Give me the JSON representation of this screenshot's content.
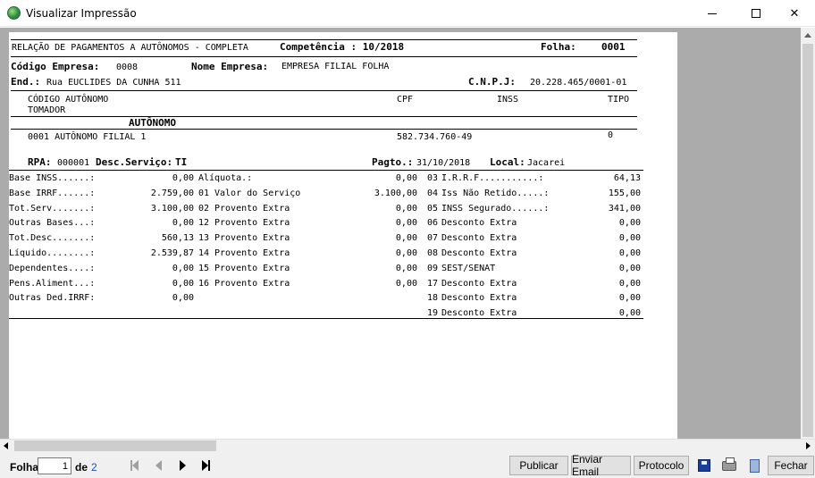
{
  "window": {
    "title": "Visualizar Impressão"
  },
  "report": {
    "header": {
      "title": "RELAÇÃO DE PAGAMENTOS A AUTÔNOMOS - COMPLETA",
      "competencia_label": "Competência : 10/2018",
      "folha_label": "Folha:",
      "folha_value": "0001"
    },
    "empresa": {
      "codigo_label": "Código Empresa:",
      "codigo_value": "0008",
      "nome_label": "Nome Empresa:",
      "nome_value": "EMPRESA FILIAL FOLHA",
      "end_label": "End.:",
      "end_value": "Rua EUCLIDES DA CUNHA 511",
      "cnpj_label": "C.N.P.J:",
      "cnpj_value": "20.228.465/0001-01"
    },
    "columns": {
      "codigo_autonomo": "CÓDIGO AUTÔNOMO",
      "tomador": "TOMADOR",
      "cpf": "CPF",
      "inss": "INSS",
      "tipo": "TIPO",
      "autonomo_section": "AUTÔNOMO"
    },
    "autonomo": {
      "codigo_nome": "0001 AUTÔNOMO FILIAL 1",
      "cpf": "582.734.760-49",
      "tipo": "0"
    },
    "rpa": {
      "rpa_label": "RPA:",
      "rpa_value": "000001",
      "desc_label": "Desc.Serviço:",
      "desc_value": "TI",
      "pagto_label": "Pagto.:",
      "pagto_value": "31/10/2018",
      "local_label": "Local:",
      "local_value": "Jacarei"
    },
    "rows": [
      {
        "l_label": "Base INSS......:",
        "l_value": "0,00",
        "m_code": "",
        "m_label": "Alíquota.:",
        "m_value": "0,00",
        "r_code": "03",
        "r_label": "I.R.R.F...........:",
        "r_value": "64,13"
      },
      {
        "l_label": "Base IRRF......:",
        "l_value": "2.759,00",
        "m_code": "01",
        "m_label": "Valor do Serviço",
        "m_value": "3.100,00",
        "r_code": "04",
        "r_label": "Iss Não Retido.....:",
        "r_value": "155,00"
      },
      {
        "l_label": "Tot.Serv.......:",
        "l_value": "3.100,00",
        "m_code": "02",
        "m_label": "Provento Extra",
        "m_value": "0,00",
        "r_code": "05",
        "r_label": "INSS Segurado......:",
        "r_value": "341,00"
      },
      {
        "l_label": "Outras Bases...:",
        "l_value": "0,00",
        "m_code": "12",
        "m_label": "Provento Extra",
        "m_value": "0,00",
        "r_code": "06",
        "r_label": "Desconto Extra",
        "r_value": "0,00"
      },
      {
        "l_label": "Tot.Desc.......:",
        "l_value": "560,13",
        "m_code": "13",
        "m_label": "Provento Extra",
        "m_value": "0,00",
        "r_code": "07",
        "r_label": "Desconto Extra",
        "r_value": "0,00"
      },
      {
        "l_label": "Líquido........:",
        "l_value": "2.539,87",
        "m_code": "14",
        "m_label": "Provento Extra",
        "m_value": "0,00",
        "r_code": "08",
        "r_label": "Desconto Extra",
        "r_value": "0,00"
      },
      {
        "l_label": "Dependentes....:",
        "l_value": "0,00",
        "m_code": "15",
        "m_label": "Provento Extra",
        "m_value": "0,00",
        "r_code": "09",
        "r_label": "SEST/SENAT",
        "r_value": "0,00"
      },
      {
        "l_label": "Pens.Aliment...:",
        "l_value": "0,00",
        "m_code": "16",
        "m_label": "Provento Extra",
        "m_value": "0,00",
        "r_code": "17",
        "r_label": "Desconto Extra",
        "r_value": "0,00"
      },
      {
        "l_label": "Outras Ded.IRRF:",
        "l_value": "0,00",
        "m_code": "",
        "m_label": "",
        "m_value": "",
        "r_code": "18",
        "r_label": "Desconto Extra",
        "r_value": "0,00"
      },
      {
        "l_label": "",
        "l_value": "",
        "m_code": "",
        "m_label": "",
        "m_value": "",
        "r_code": "19",
        "r_label": "Desconto Extra",
        "r_value": "0,00"
      }
    ]
  },
  "toolbar": {
    "folha_label": "Folha",
    "page_value": "1",
    "de_label": "de",
    "total_pages": "2",
    "publicar": "Publicar",
    "enviar_email": "Enviar Email",
    "protocolo": "Protocolo",
    "fechar": "Fechar"
  },
  "icons": {
    "app": "app-globe-icon",
    "save": "floppy-disk-icon",
    "print": "printer-icon",
    "doc": "document-icon"
  }
}
